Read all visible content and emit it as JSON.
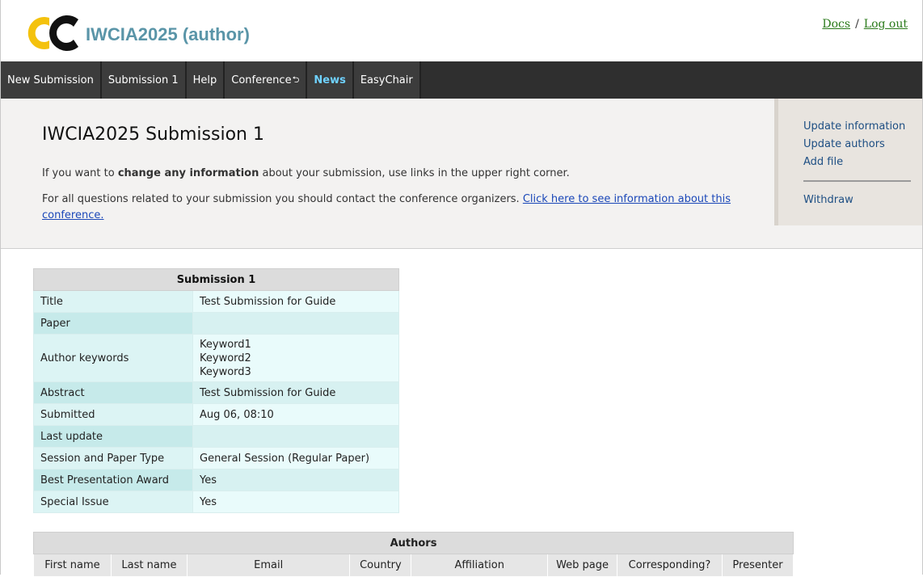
{
  "header": {
    "app_title": "IWCIA2025 (author)",
    "links": {
      "docs": "Docs",
      "separator": "/",
      "logout": "Log out"
    }
  },
  "menu": [
    {
      "label": "New Submission"
    },
    {
      "label": "Submission 1"
    },
    {
      "label": "Help"
    },
    {
      "label": "Conference",
      "has_icon": true
    },
    {
      "label": "News"
    },
    {
      "label": "EasyChair"
    }
  ],
  "page": {
    "title": "IWCIA2025 Submission 1",
    "info_line1_pre": "If you want to ",
    "info_line1_bold": "change any information",
    "info_line1_post": " about your submission, use links in the upper right corner.",
    "info_line2_pre": "For all questions related to your submission you should contact the conference organizers. ",
    "info_line2_link": "Click here to see information about this conference."
  },
  "side_links": {
    "update_information": "Update information",
    "update_authors": "Update authors",
    "add_file": "Add file",
    "withdraw": "Withdraw"
  },
  "submission_table": {
    "caption": "Submission 1",
    "rows": [
      {
        "key": "Title",
        "value": "Test Submission for Guide"
      },
      {
        "key": "Paper",
        "value": ""
      },
      {
        "key": "Author keywords",
        "value_lines": [
          "Keyword1",
          "Keyword2",
          "Keyword3"
        ]
      },
      {
        "key": "Abstract",
        "value": "Test Submission for Guide"
      },
      {
        "key": "Submitted",
        "value": "Aug 06, 08:10"
      },
      {
        "key": "Last update",
        "value": ""
      },
      {
        "key": "Session and Paper Type",
        "value": "General Session (Regular Paper)"
      },
      {
        "key": "Best Presentation Award",
        "value": "Yes"
      },
      {
        "key": "Special Issue",
        "value": "Yes"
      }
    ]
  },
  "authors_table": {
    "caption": "Authors",
    "columns": [
      "First name",
      "Last name",
      "Email",
      "Country",
      "Affiliation",
      "Web page",
      "Corresponding?",
      "Presenter"
    ]
  },
  "colors": {
    "menu_bg": "#2f2f2f",
    "news_accent": "#6fd2ff",
    "title_accent": "#5a95a8",
    "link_green": "#2a7a1a",
    "link_blue": "#1a47b8",
    "logo_yellow": "#f4c20d"
  }
}
